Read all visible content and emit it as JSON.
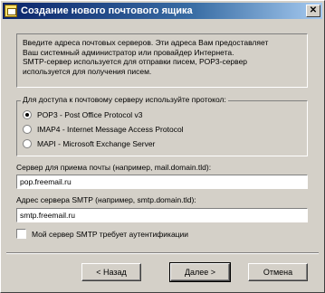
{
  "window": {
    "title": "Создание нового почтового ящика",
    "close_glyph": "✕"
  },
  "info": {
    "lines": [
      "Введите адреса почтовых серверов. Эти адреса Вам предоставляет",
      "Ваш системный администратор или провайдер Интернета.",
      "SMTP-сервер используется для отправки писем, POP3-сервер",
      "используется для получения писем."
    ]
  },
  "protocol_group": {
    "legend": "Для доступа к почтовому серверу используйте протокол:",
    "options": [
      {
        "label": "POP3 - Post Office Protocol v3",
        "checked": true
      },
      {
        "label": "IMAP4 - Internet Message Access Protocol",
        "checked": false
      },
      {
        "label": "MAPI - Microsoft Exchange Server",
        "checked": false
      }
    ]
  },
  "incoming": {
    "label": "Сервер для приема почты (например, mail.domain.tld):",
    "value": "pop.freemail.ru"
  },
  "smtp": {
    "label": "Адрес сервера SMTP (например, smtp.domain.tld):",
    "value": "smtp.freemail.ru"
  },
  "auth_checkbox": {
    "label": "Мой сервер SMTP требует аутентификации",
    "checked": false
  },
  "buttons": {
    "back": "< Назад",
    "next": "Далее >",
    "cancel": "Отмена"
  }
}
